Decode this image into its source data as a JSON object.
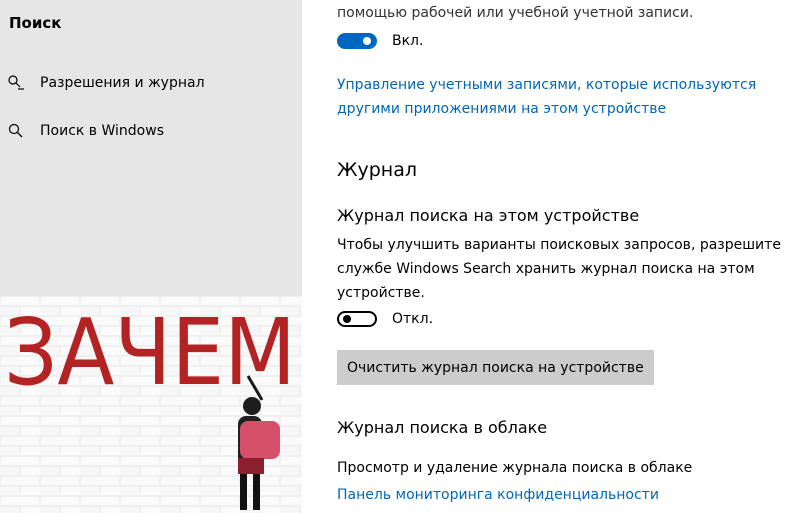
{
  "sidebar": {
    "title": "Поиск",
    "items": [
      {
        "label": "Разрешения и журнал",
        "icon": "magnifier-list-icon"
      },
      {
        "label": "Поиск в Windows",
        "icon": "search-icon"
      }
    ],
    "art_text": "ЗАЧЕМ"
  },
  "account": {
    "text_partial": "помощью рабочей или учебной учетной записи.",
    "toggle_state": "Вкл.",
    "manage_link_line1": "Управление учетными записями, которые используются",
    "manage_link_line2": "другими приложениями на этом устройстве"
  },
  "history": {
    "heading": "Журнал",
    "device_heading": "Журнал поиска на этом устройстве",
    "device_desc_line1": "Чтобы улучшить варианты поисковых запросов, разрешите",
    "device_desc_line2": "службе Windows Search хранить журнал поиска на этом",
    "device_desc_line3": "устройстве.",
    "device_toggle_state": "Откл.",
    "clear_button": "Очистить журнал поиска на устройстве",
    "cloud_heading": "Журнал поиска в облаке",
    "cloud_desc": "Просмотр и удаление журнала поиска в облаке",
    "privacy_link": "Панель мониторинга конфиденциальности"
  },
  "colors": {
    "accent": "#0067c0",
    "link": "#0067b8",
    "sidebar_bg": "#e6e6e6"
  }
}
